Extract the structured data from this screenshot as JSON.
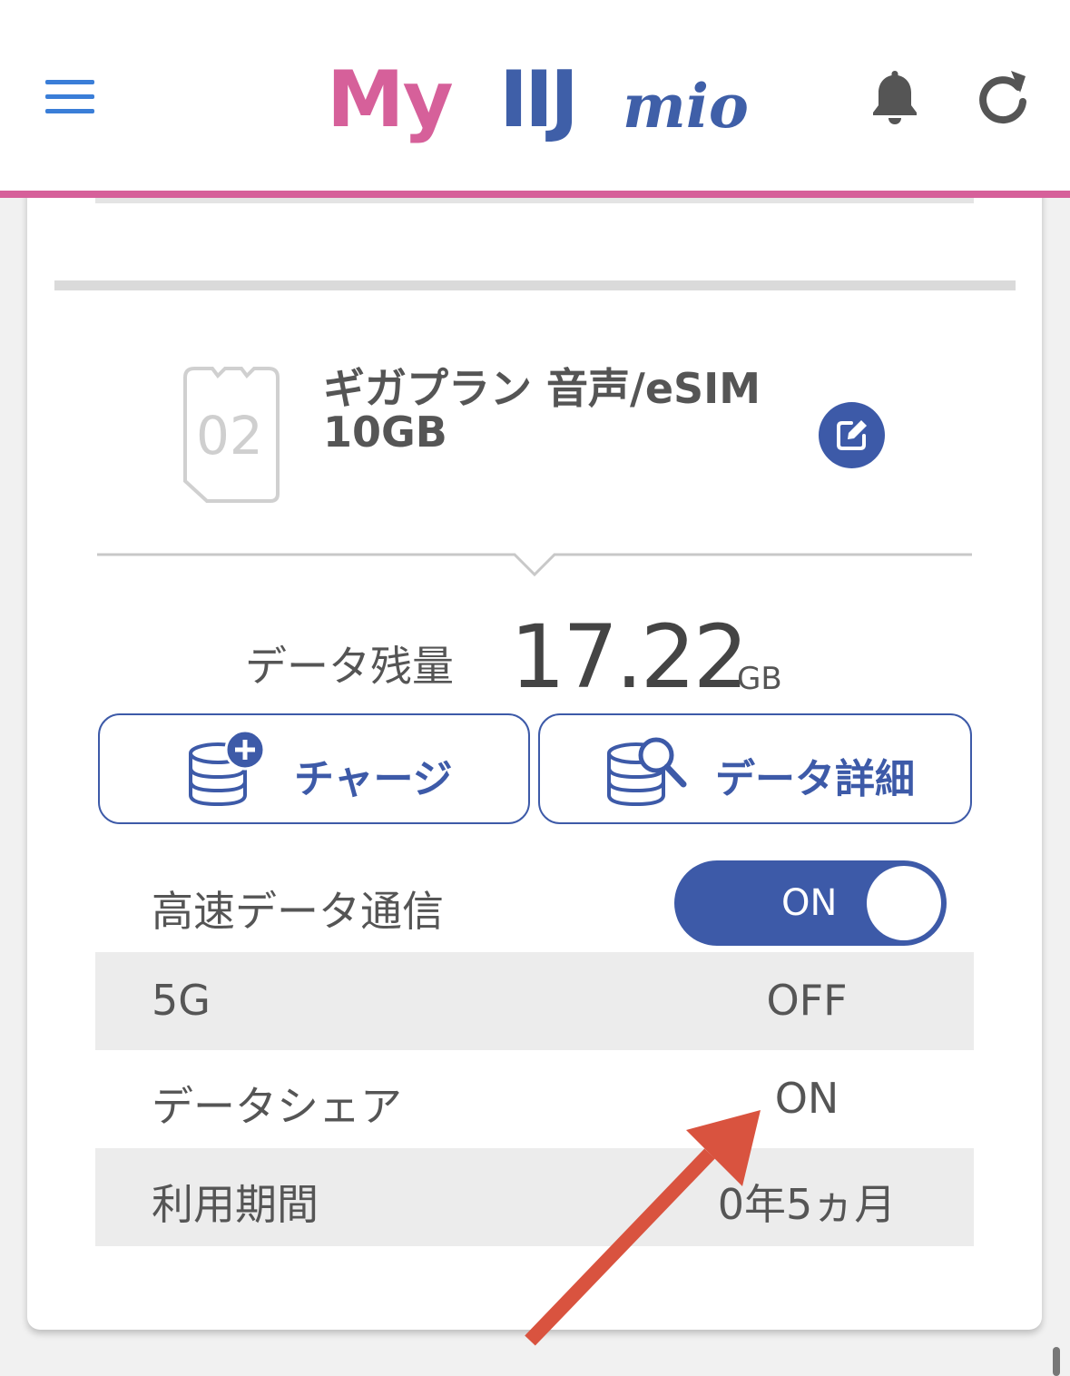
{
  "header": {
    "logo_my": "My",
    "logo_iij": "IIJ",
    "logo_mio": "mio"
  },
  "sim": {
    "number": "02",
    "plan_name_line1": "ギガプラン 音声/eSIM",
    "plan_name_line2": "10GB"
  },
  "data": {
    "label": "データ残量",
    "value": "17.22",
    "unit": "GB"
  },
  "buttons": {
    "charge": "チャージ",
    "detail": "データ詳細"
  },
  "settings": [
    {
      "label": "高速データ通信",
      "value": "ON"
    },
    {
      "label": "5G",
      "value": "OFF"
    },
    {
      "label": "データシェア",
      "value": "ON"
    },
    {
      "label": "利用期間",
      "value": "0年5ヵ月"
    }
  ],
  "colors": {
    "accent_pink": "#d6609a",
    "brand_blue": "#3d5aa8",
    "arrow_red": "#d9533f"
  }
}
